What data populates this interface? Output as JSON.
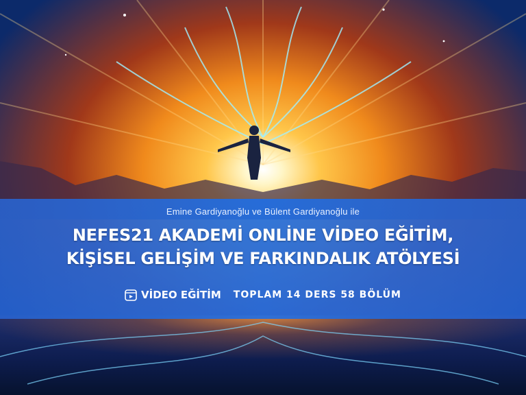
{
  "banner": {
    "byline": "Emine Gardiyanoğlu ve Bülent Gardiyanoğlu ile",
    "title_line1": "NEFES21 AKADEMİ ONLİNE VİDEO EĞİTİM,",
    "title_line2": "KİŞİSEL GELİŞİM VE FARKINDALIK ATÖLYESİ",
    "video_label": "VİDEO EĞİTİM",
    "video_icon": "video-play-icon",
    "total_label": "TOPLAM 14 DERS 58 BÖLÜM"
  },
  "colors": {
    "banner": "#2a6ed8",
    "sky_gold": "#f5a623",
    "sky_blue": "#1a3a8a",
    "energy_cyan": "#7fe3ff"
  }
}
